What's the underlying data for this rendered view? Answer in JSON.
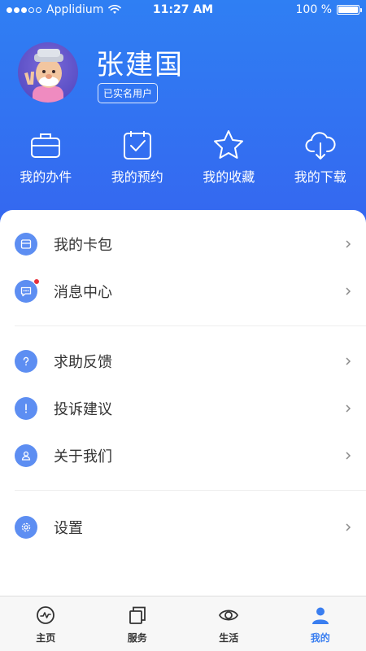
{
  "status_bar": {
    "carrier": "Applidium",
    "time": "11:27 AM",
    "battery": "100 %"
  },
  "profile": {
    "name": "张建国",
    "badge": "已实名用户"
  },
  "quick_actions": [
    {
      "label": "我的办件",
      "icon": "briefcase-icon"
    },
    {
      "label": "我的预约",
      "icon": "calendar-check-icon"
    },
    {
      "label": "我的收藏",
      "icon": "star-icon"
    },
    {
      "label": "我的下载",
      "icon": "cloud-download-icon"
    }
  ],
  "menu": {
    "card_wallet": "我的卡包",
    "message_center": "消息中心",
    "help_feedback": "求助反馈",
    "complaint": "投诉建议",
    "about_us": "关于我们",
    "settings": "设置"
  },
  "tabs": [
    {
      "label": "主页",
      "icon": "pulse-icon",
      "active": false
    },
    {
      "label": "服务",
      "icon": "copy-icon",
      "active": false
    },
    {
      "label": "生活",
      "icon": "eye-icon",
      "active": false
    },
    {
      "label": "我的",
      "icon": "user-icon",
      "active": true
    }
  ],
  "colors": {
    "accent": "#3a7ef0",
    "header_top": "#2f7ff3",
    "header_bottom": "#3566f0",
    "menu_icon_bg": "#5d8ef2",
    "notification_dot": "#e8313b"
  }
}
